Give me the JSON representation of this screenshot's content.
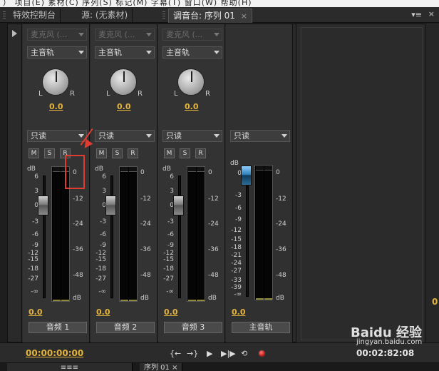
{
  "menu_fragment": "） 项目(E) 素材(C) 序列(S) 标记(M) 字幕(T) 窗口(W) 帮助(H)",
  "tabs": [
    {
      "label": "特效控制台"
    },
    {
      "label": "源: (无素材)"
    },
    {
      "label": "调音台: 序列 01"
    }
  ],
  "tab_close_glyph": "×",
  "panel_menu_glyph": "▾≡",
  "panel_close_glyph": "×",
  "strips": [
    {
      "input": "麦克风 (...",
      "track_type": "主音轨",
      "pan_value": "0.0",
      "automation": "只读",
      "buttons": [
        "M",
        "S",
        "R"
      ],
      "volume": "0.0",
      "name": "音频 1"
    },
    {
      "input": "麦克风 (...",
      "track_type": "主音轨",
      "pan_value": "0.0",
      "automation": "只读",
      "buttons": [
        "M",
        "S",
        "R"
      ],
      "volume": "0.0",
      "name": "音频 2"
    },
    {
      "input": "麦克风 (...",
      "track_type": "主音轨",
      "pan_value": "0.0",
      "automation": "只读",
      "buttons": [
        "M",
        "S",
        "R"
      ],
      "volume": "0.0",
      "name": "音频 3"
    }
  ],
  "master": {
    "automation": "只读",
    "volume": "0.0",
    "name": "主音轨"
  },
  "pan_labels": {
    "left": "L",
    "right": "R"
  },
  "db_label": "dB",
  "fader_scale": [
    "6",
    "3",
    "0",
    "-3",
    "-6",
    "-9",
    "-12",
    "-15",
    "-18",
    "-27",
    "-∞"
  ],
  "master_fader_scale": [
    "0",
    "-3",
    "-6",
    "-9",
    "-12",
    "-15",
    "-18",
    "-21",
    "-24",
    "-27",
    "-33",
    "-39",
    "-∞"
  ],
  "meter_scale": [
    "0",
    "-12",
    "-24",
    "-36",
    "-48",
    "dB"
  ],
  "timecode_current": "00:00:00:00",
  "timecode_duration": "00:02:82:08",
  "transport": {
    "to_in": "{←",
    "to_out": "→}",
    "play": "▶",
    "play_in_out": "▶|▶",
    "loop": "⟲",
    "record": ""
  },
  "bottom_tabs": [
    {
      "label": "≡≡≡"
    },
    {
      "label": "序列 01 ×"
    }
  ],
  "side_value": "0",
  "watermark": {
    "line1": "Baidu 经验",
    "line2": "jingyan.baidu.com"
  }
}
